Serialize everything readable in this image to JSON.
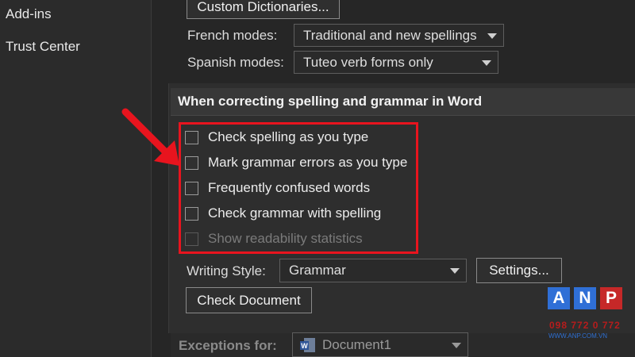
{
  "nav": {
    "items": [
      {
        "label": "Add-ins"
      },
      {
        "label": "Trust Center"
      }
    ]
  },
  "dictionaries_button": "Custom Dictionaries...",
  "french": {
    "label": "French modes:",
    "value": "Traditional and new spellings"
  },
  "spanish": {
    "label": "Spanish modes:",
    "value": "Tuteo verb forms only"
  },
  "section": {
    "title": "When correcting spelling and grammar in Word",
    "options": [
      {
        "label": "Check spelling as you type",
        "checked": false,
        "enabled": true
      },
      {
        "label": "Mark grammar errors as you type",
        "checked": false,
        "enabled": true
      },
      {
        "label": "Frequently confused words",
        "checked": false,
        "enabled": true
      },
      {
        "label": "Check grammar with spelling",
        "checked": false,
        "enabled": true
      },
      {
        "label": "Show readability statistics",
        "checked": false,
        "enabled": false
      }
    ],
    "writing_style": {
      "label": "Writing Style:",
      "value": "Grammar"
    },
    "settings_button": "Settings...",
    "check_document_button": "Check Document"
  },
  "exceptions": {
    "label": "Exceptions for:",
    "value": "Document1"
  },
  "logo": {
    "letters": [
      "A",
      "N",
      "P"
    ],
    "colors": {
      "a": "#2f6fd6",
      "n": "#2f6fd6",
      "p": "#c62828"
    },
    "phone": "098 772 0 772",
    "website": "WWW.ANP.COM.VN"
  },
  "colors": {
    "highlight": "#e8141e",
    "arrow": "#e8141e",
    "background": "#262626"
  }
}
